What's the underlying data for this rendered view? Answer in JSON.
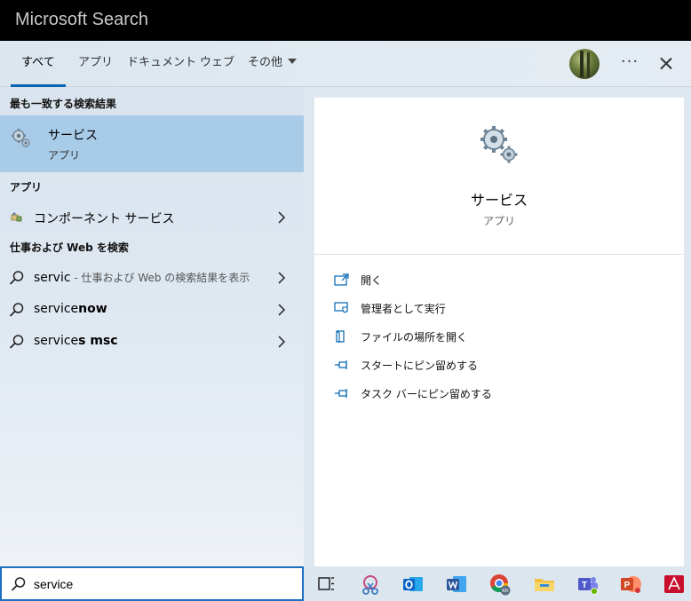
{
  "window": {
    "title": "Microsoft Search"
  },
  "tabs": [
    {
      "label": "すべて",
      "active": true
    },
    {
      "label": "アプリ"
    },
    {
      "label": "ドキュメント"
    },
    {
      "label": "ウェブ"
    },
    {
      "label": "その他"
    }
  ],
  "header": {
    "more_label": "···"
  },
  "left": {
    "best_match_heading": "最も一致する検索結果",
    "best_match": {
      "title": "サービス",
      "subtitle": "アプリ",
      "icon": "gears-icon"
    },
    "apps_heading": "アプリ",
    "apps": [
      {
        "label": "コンポーネント サービス",
        "icon": "component-services-icon"
      }
    ],
    "web_heading": "仕事および Web を検索",
    "web": [
      {
        "label": "servic",
        "suffix": " - 仕事および Web の検索結果を表示"
      },
      {
        "label": "service",
        "bold": "now"
      },
      {
        "label": "service",
        "bold": "s msc"
      }
    ]
  },
  "preview": {
    "title": "サービス",
    "subtitle": "アプリ",
    "actions": [
      {
        "label": "開く",
        "icon": "open-icon"
      },
      {
        "label": "管理者として実行",
        "icon": "shield-admin-icon"
      },
      {
        "label": "ファイルの場所を開く",
        "icon": "file-location-icon"
      },
      {
        "label": "スタートにピン留めする",
        "icon": "pin-icon"
      },
      {
        "label": "タスク バーにピン留めする",
        "icon": "pin-icon"
      }
    ]
  },
  "search": {
    "value": "service",
    "icon": "search-icon"
  },
  "taskbar": {
    "items": [
      "task-view-icon",
      "snipping-icon",
      "outlook-icon",
      "word-icon",
      "chrome-icon",
      "file-explorer-icon",
      "teams-icon",
      "powerpoint-icon",
      "acrobat-icon"
    ],
    "colors": {
      "outlook": "#0a64c8",
      "word": "#2b579a",
      "powerpoint": "#d24726",
      "acrobat": "#c8102e",
      "folder": "#f0c040",
      "teams": "#5059c9"
    }
  },
  "colors": {
    "accent": "#0063b1",
    "selection": "#a8cbe8"
  }
}
